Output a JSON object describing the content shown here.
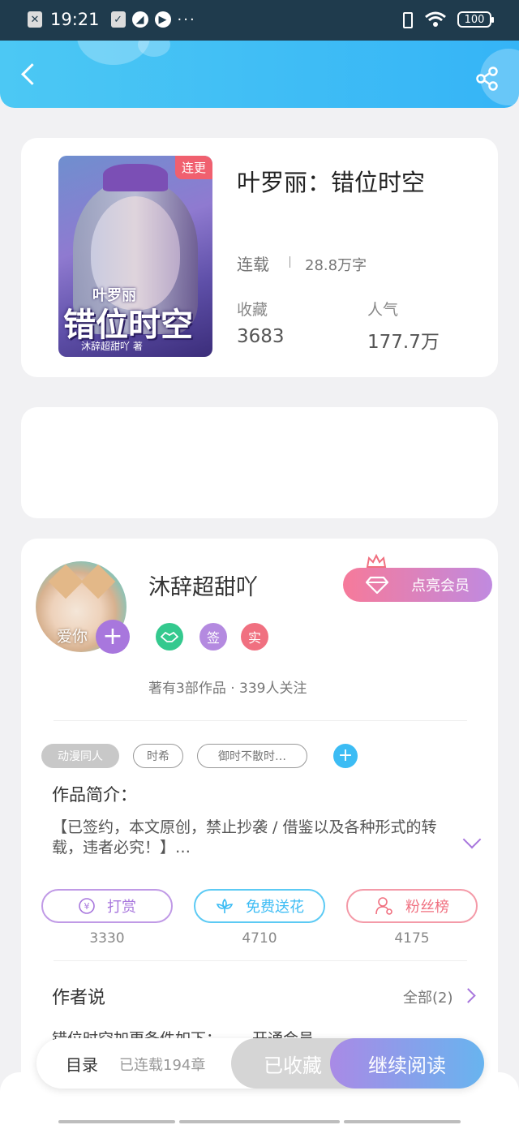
{
  "status_bar": {
    "time": "19:21",
    "battery": "100",
    "more": "···"
  },
  "book": {
    "title": "叶罗丽：错位时空",
    "update_tag": "连更",
    "cover_title": "错位时空",
    "cover_subtitle": "叶罗丽",
    "cover_author": "沐辞超甜吖 著",
    "status": "连载",
    "word_count": "28.8万字",
    "stats": [
      {
        "label": "收藏",
        "value": "3683"
      },
      {
        "label": "人气",
        "value": "177.7万"
      }
    ]
  },
  "author": {
    "name": "沐辞超甜吖",
    "avatar_text": "爱你",
    "vip_label": "点亮会员",
    "badges": [
      {
        "icon": "handshake-icon",
        "text": "",
        "color": "#34c98e"
      },
      {
        "icon": "sign-badge",
        "text": "签",
        "color": "#b48ae0"
      },
      {
        "icon": "real-badge",
        "text": "实",
        "color": "#f07080"
      }
    ],
    "meta": "著有3部作品 · 339人关注"
  },
  "tags": [
    "动漫同人",
    "时希",
    "御时不散时…"
  ],
  "intro": {
    "label": "作品简介：",
    "text": "【已签约，本文原创，禁止抄袭 / 借鉴以及各种形式的转载，违者必究！】…"
  },
  "actions": [
    {
      "label": "打赏",
      "count": "3330",
      "color": "#a877dd",
      "icon": "yen-icon"
    },
    {
      "label": "免费送花",
      "count": "4710",
      "color": "#3cbcf4",
      "icon": "flower-icon"
    },
    {
      "label": "粉丝榜",
      "count": "4175",
      "color": "#f07080",
      "icon": "fans-icon"
    }
  ],
  "author_section": {
    "title": "作者说",
    "more": "全部(2)",
    "preview": "错位时空加更条件如下：——开通会员"
  },
  "bottom_bar": {
    "catalog": "目录",
    "chapters": "已连载194章",
    "collected": "已收藏",
    "continue": "继续阅读"
  }
}
